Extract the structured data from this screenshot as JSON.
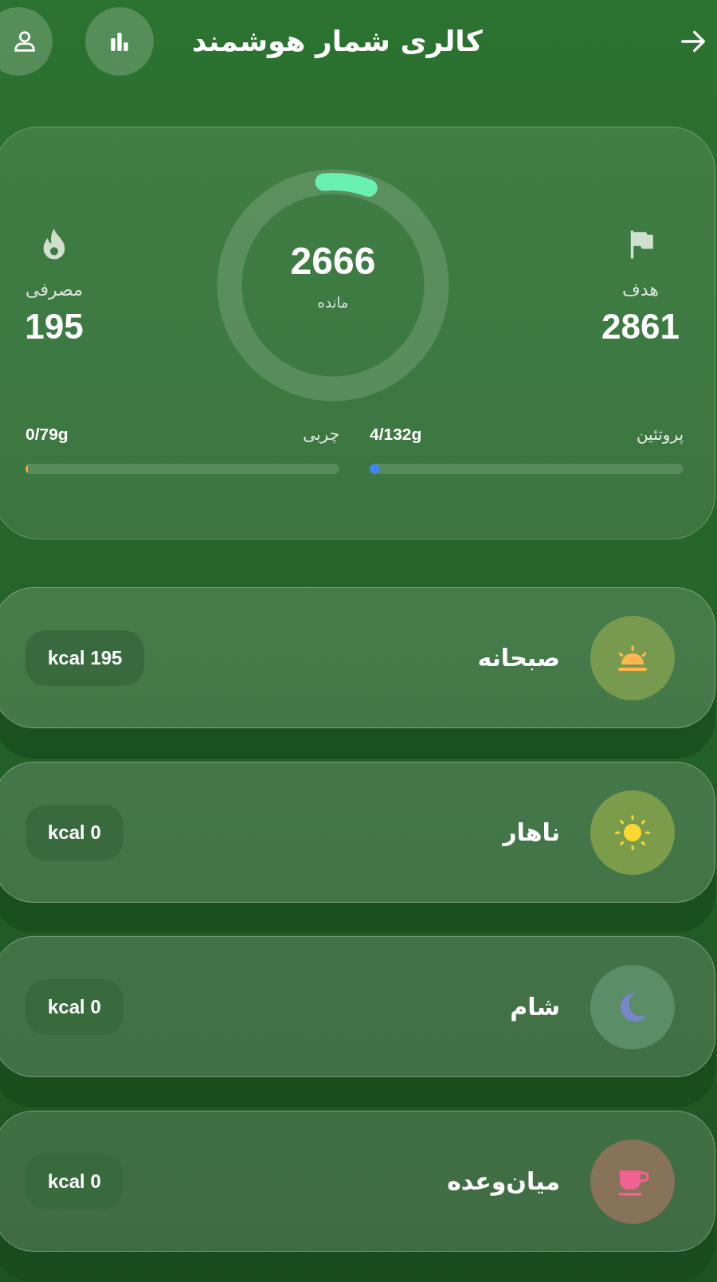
{
  "header": {
    "title": "کالری شمار هوشمند"
  },
  "summary": {
    "goal": {
      "label": "هدف",
      "value": "2861"
    },
    "remaining": {
      "value": "2666",
      "label": "مانده",
      "level": 0.07
    },
    "consumed": {
      "label": "مصرفی",
      "value": "195"
    },
    "macros": [
      {
        "name": "پروتئین",
        "amount": "4/132g",
        "level": 0.03,
        "color": "#4285f4"
      },
      {
        "name": "چربی",
        "amount": "0/79g",
        "level": 0,
        "color": "#ffa726"
      }
    ]
  },
  "meals": [
    {
      "kind": "breakfast",
      "name": "صبحانه",
      "calories": "kcal 195"
    },
    {
      "kind": "lunch",
      "name": "ناهار",
      "calories": "kcal 0"
    },
    {
      "kind": "dinner",
      "name": "شام",
      "calories": "kcal 0"
    },
    {
      "kind": "snack",
      "name": "میان‌وعده",
      "calories": "kcal 0"
    }
  ]
}
